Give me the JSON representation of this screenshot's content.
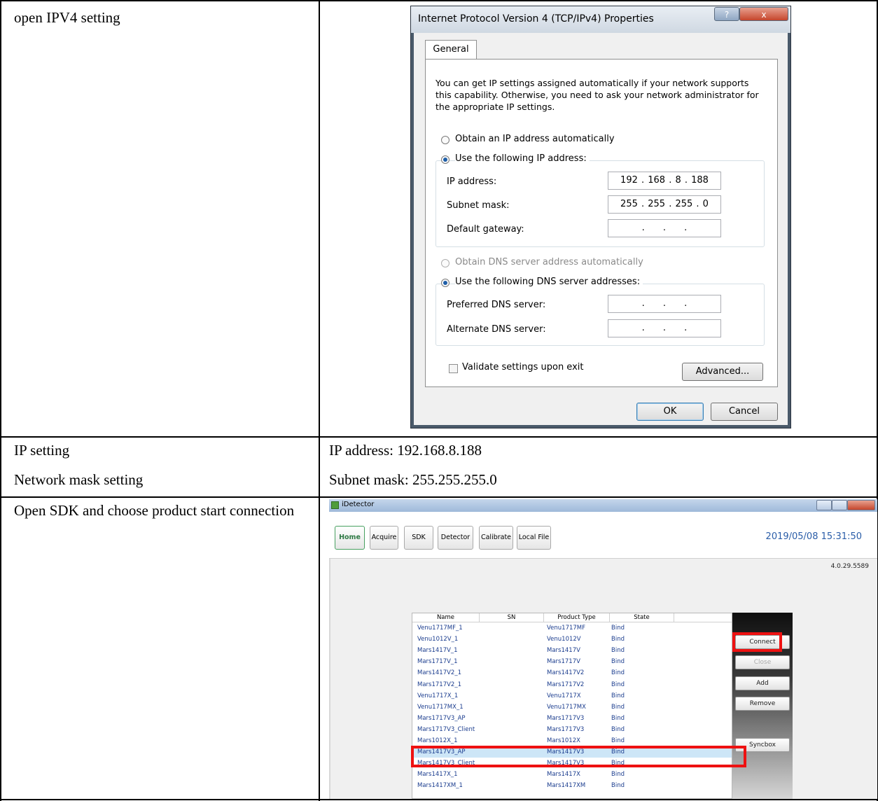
{
  "rows": [
    {
      "left": "open IPV4 setting"
    },
    {
      "left_lines": [
        "IP setting",
        "Network mask setting"
      ],
      "right_lines": [
        "IP address: 192.168.8.188",
        "Subnet mask: 255.255.255.0"
      ]
    },
    {
      "left": "Open SDK and choose product start connection"
    }
  ],
  "ipv4_dialog": {
    "title": "Internet Protocol Version 4 (TCP/IPv4) Properties",
    "help_glyph": "?",
    "close_glyph": "x",
    "tab": "General",
    "intro": "You can get IP settings assigned automatically if your network supports this capability. Otherwise, you need to ask your network administrator for the appropriate IP settings.",
    "ip_auto": "Obtain an IP address automatically",
    "ip_manual": "Use the following IP address:",
    "ip_address_label": "IP address:",
    "ip_address_value": "192 . 168 . 8 . 188",
    "subnet_label": "Subnet mask:",
    "subnet_value": "255 . 255 . 255 . 0",
    "gateway_label": "Default gateway:",
    "gateway_value": ". . .",
    "dns_auto": "Obtain DNS server address automatically",
    "dns_manual": "Use the following DNS server addresses:",
    "preferred_label": "Preferred DNS server:",
    "preferred_value": ". . .",
    "alternate_label": "Alternate DNS server:",
    "alternate_value": ". . .",
    "validate_label": "Validate settings upon exit",
    "advanced_button": "Advanced...",
    "ok_button": "OK",
    "cancel_button": "Cancel"
  },
  "idetector": {
    "title": "iDetector",
    "tabs": [
      "Home",
      "Acquire",
      "SDK",
      "Detector",
      "Calibrate",
      "Local File"
    ],
    "datetime": "2019/05/08 15:31:50",
    "version": "4.0.29.5589",
    "columns": [
      "Name",
      "SN",
      "Product Type",
      "State"
    ],
    "devices": [
      {
        "name": "Venu1717MF_1",
        "sn": "",
        "type": "Venu1717MF",
        "state": "Bind"
      },
      {
        "name": "Venu1012V_1",
        "sn": "",
        "type": "Venu1012V",
        "state": "Bind"
      },
      {
        "name": "Mars1417V_1",
        "sn": "",
        "type": "Mars1417V",
        "state": "Bind"
      },
      {
        "name": "Mars1717V_1",
        "sn": "",
        "type": "Mars1717V",
        "state": "Bind"
      },
      {
        "name": "Mars1417V2_1",
        "sn": "",
        "type": "Mars1417V2",
        "state": "Bind"
      },
      {
        "name": "Mars1717V2_1",
        "sn": "",
        "type": "Mars1717V2",
        "state": "Bind"
      },
      {
        "name": "Venu1717X_1",
        "sn": "",
        "type": "Venu1717X",
        "state": "Bind"
      },
      {
        "name": "Venu1717MX_1",
        "sn": "",
        "type": "Venu1717MX",
        "state": "Bind"
      },
      {
        "name": "Mars1717V3_AP",
        "sn": "",
        "type": "Mars1717V3",
        "state": "Bind"
      },
      {
        "name": "Mars1717V3_Client",
        "sn": "",
        "type": "Mars1717V3",
        "state": "Bind"
      },
      {
        "name": "Mars1012X_1",
        "sn": "",
        "type": "Mars1012X",
        "state": "Bind"
      },
      {
        "name": "Mars1417V3_AP",
        "sn": "",
        "type": "Mars1417V3",
        "state": "Bind"
      },
      {
        "name": "Mars1417V3_Client",
        "sn": "",
        "type": "Mars1417V3",
        "state": "Bind"
      },
      {
        "name": "Mars1417X_1",
        "sn": "",
        "type": "Mars1417X",
        "state": "Bind"
      },
      {
        "name": "Mars1417XM_1",
        "sn": "",
        "type": "Mars1417XM",
        "state": "Bind"
      }
    ],
    "selected_device": "Mars1417V3_AP",
    "buttons": {
      "connect": "Connect",
      "close": "Close",
      "add": "Add",
      "remove": "Remove",
      "syncbox": "Syncbox"
    },
    "highlight_color": "#ee1111"
  }
}
